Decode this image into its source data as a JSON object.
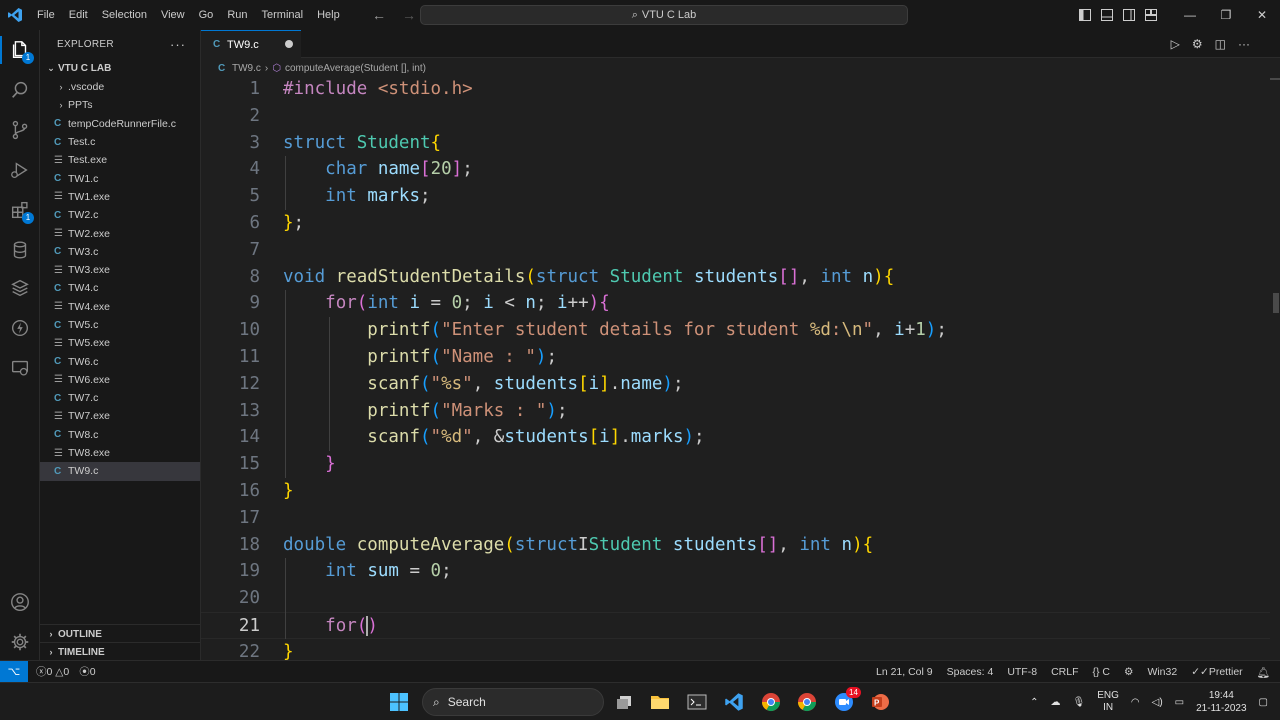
{
  "titlebar": {
    "menu": [
      "File",
      "Edit",
      "Selection",
      "View",
      "Go",
      "Run",
      "Terminal",
      "Help"
    ],
    "search_text": "VTU C Lab"
  },
  "sidebar": {
    "header": "EXPLORER",
    "root_folder": "VTU C LAB",
    "items": [
      {
        "name": ".vscode",
        "kind": "folder"
      },
      {
        "name": "PPTs",
        "kind": "folder"
      },
      {
        "name": "tempCodeRunnerFile.c",
        "kind": "c"
      },
      {
        "name": "Test.c",
        "kind": "c"
      },
      {
        "name": "Test.exe",
        "kind": "exe"
      },
      {
        "name": "TW1.c",
        "kind": "c"
      },
      {
        "name": "TW1.exe",
        "kind": "exe"
      },
      {
        "name": "TW2.c",
        "kind": "c"
      },
      {
        "name": "TW2.exe",
        "kind": "exe"
      },
      {
        "name": "TW3.c",
        "kind": "c"
      },
      {
        "name": "TW3.exe",
        "kind": "exe"
      },
      {
        "name": "TW4.c",
        "kind": "c"
      },
      {
        "name": "TW4.exe",
        "kind": "exe"
      },
      {
        "name": "TW5.c",
        "kind": "c"
      },
      {
        "name": "TW5.exe",
        "kind": "exe"
      },
      {
        "name": "TW6.c",
        "kind": "c"
      },
      {
        "name": "TW6.exe",
        "kind": "exe"
      },
      {
        "name": "TW7.c",
        "kind": "c"
      },
      {
        "name": "TW7.exe",
        "kind": "exe"
      },
      {
        "name": "TW8.c",
        "kind": "c"
      },
      {
        "name": "TW8.exe",
        "kind": "exe"
      },
      {
        "name": "TW9.c",
        "kind": "c",
        "selected": true
      }
    ],
    "outline_label": "OUTLINE",
    "timeline_label": "TIMELINE",
    "file_icon_c": "C",
    "file_icon_exe": "☰"
  },
  "activity": {
    "extensions_badge": "1",
    "explorer_badge": "1"
  },
  "editor": {
    "tab_label": "TW9.c",
    "tab_icon": "C",
    "breadcrumb_file": "TW9.c",
    "breadcrumb_symbol": "computeAverage(Student [], int)",
    "lines": [
      [
        [
          "kw-pre",
          "#include"
        ],
        [
          "punc",
          " "
        ],
        [
          "inc",
          "<stdio.h>"
        ]
      ],
      [],
      [
        [
          "kw",
          "struct"
        ],
        [
          "punc",
          " "
        ],
        [
          "type",
          "Student"
        ],
        [
          "br1",
          "{"
        ]
      ],
      [
        [
          "punc",
          "    "
        ],
        [
          "kw",
          "char"
        ],
        [
          "punc",
          " "
        ],
        [
          "var",
          "name"
        ],
        [
          "br2",
          "["
        ],
        [
          "num",
          "20"
        ],
        [
          "br2",
          "]"
        ],
        [
          "punc",
          ";"
        ]
      ],
      [
        [
          "punc",
          "    "
        ],
        [
          "kw",
          "int"
        ],
        [
          "punc",
          " "
        ],
        [
          "var",
          "marks"
        ],
        [
          "punc",
          ";"
        ]
      ],
      [
        [
          "br1",
          "}"
        ],
        [
          "punc",
          ";"
        ]
      ],
      [],
      [
        [
          "kw",
          "void"
        ],
        [
          "punc",
          " "
        ],
        [
          "fn",
          "readStudentDetails"
        ],
        [
          "br1",
          "("
        ],
        [
          "kw",
          "struct"
        ],
        [
          "punc",
          " "
        ],
        [
          "type",
          "Student"
        ],
        [
          "punc",
          " "
        ],
        [
          "var",
          "students"
        ],
        [
          "br2",
          "[]"
        ],
        [
          "punc",
          ", "
        ],
        [
          "kw",
          "int"
        ],
        [
          "punc",
          " "
        ],
        [
          "var",
          "n"
        ],
        [
          "br1",
          ")"
        ],
        [
          "br1",
          "{"
        ]
      ],
      [
        [
          "punc",
          "    "
        ],
        [
          "ctrl",
          "for"
        ],
        [
          "br2",
          "("
        ],
        [
          "kw",
          "int"
        ],
        [
          "punc",
          " "
        ],
        [
          "var",
          "i"
        ],
        [
          "punc",
          " = "
        ],
        [
          "num",
          "0"
        ],
        [
          "punc",
          "; "
        ],
        [
          "var",
          "i"
        ],
        [
          "punc",
          " < "
        ],
        [
          "var",
          "n"
        ],
        [
          "punc",
          "; "
        ],
        [
          "var",
          "i"
        ],
        [
          "punc",
          "++"
        ],
        [
          "br2",
          ")"
        ],
        [
          "br2",
          "{"
        ]
      ],
      [
        [
          "punc",
          "        "
        ],
        [
          "fn",
          "printf"
        ],
        [
          "br3",
          "("
        ],
        [
          "str",
          "\"Enter student details for student "
        ],
        [
          "esc",
          "%d"
        ],
        [
          "str",
          ":"
        ],
        [
          "esc",
          "\\n"
        ],
        [
          "str",
          "\""
        ],
        [
          "punc",
          ", "
        ],
        [
          "var",
          "i"
        ],
        [
          "punc",
          "+"
        ],
        [
          "num",
          "1"
        ],
        [
          "br3",
          ")"
        ],
        [
          "punc",
          ";"
        ]
      ],
      [
        [
          "punc",
          "        "
        ],
        [
          "fn",
          "printf"
        ],
        [
          "br3",
          "("
        ],
        [
          "str",
          "\"Name : \""
        ],
        [
          "br3",
          ")"
        ],
        [
          "punc",
          ";"
        ]
      ],
      [
        [
          "punc",
          "        "
        ],
        [
          "fn",
          "scanf"
        ],
        [
          "br3",
          "("
        ],
        [
          "str",
          "\""
        ],
        [
          "esc",
          "%s"
        ],
        [
          "str",
          "\""
        ],
        [
          "punc",
          ", "
        ],
        [
          "var",
          "students"
        ],
        [
          "br1",
          "["
        ],
        [
          "var",
          "i"
        ],
        [
          "br1",
          "]"
        ],
        [
          "punc",
          "."
        ],
        [
          "var",
          "name"
        ],
        [
          "br3",
          ")"
        ],
        [
          "punc",
          ";"
        ]
      ],
      [
        [
          "punc",
          "        "
        ],
        [
          "fn",
          "printf"
        ],
        [
          "br3",
          "("
        ],
        [
          "str",
          "\"Marks : \""
        ],
        [
          "br3",
          ")"
        ],
        [
          "punc",
          ";"
        ]
      ],
      [
        [
          "punc",
          "        "
        ],
        [
          "fn",
          "scanf"
        ],
        [
          "br3",
          "("
        ],
        [
          "str",
          "\""
        ],
        [
          "esc",
          "%d"
        ],
        [
          "str",
          "\""
        ],
        [
          "punc",
          ", &"
        ],
        [
          "var",
          "students"
        ],
        [
          "br1",
          "["
        ],
        [
          "var",
          "i"
        ],
        [
          "br1",
          "]"
        ],
        [
          "punc",
          "."
        ],
        [
          "var",
          "marks"
        ],
        [
          "br3",
          ")"
        ],
        [
          "punc",
          ";"
        ]
      ],
      [
        [
          "punc",
          "    "
        ],
        [
          "br2",
          "}"
        ]
      ],
      [
        [
          "br1",
          "}"
        ]
      ],
      [],
      [
        [
          "kw",
          "double"
        ],
        [
          "punc",
          " "
        ],
        [
          "fn",
          "computeAverage"
        ],
        [
          "br1",
          "("
        ],
        [
          "kw",
          "struct"
        ],
        [
          "cursor-i",
          "I"
        ],
        [
          "type",
          "Student"
        ],
        [
          "punc",
          " "
        ],
        [
          "var",
          "students"
        ],
        [
          "br2",
          "[]"
        ],
        [
          "punc",
          ", "
        ],
        [
          "kw",
          "int"
        ],
        [
          "punc",
          " "
        ],
        [
          "var",
          "n"
        ],
        [
          "br1",
          ")"
        ],
        [
          "br1",
          "{"
        ]
      ],
      [
        [
          "punc",
          "    "
        ],
        [
          "kw",
          "int"
        ],
        [
          "punc",
          " "
        ],
        [
          "var",
          "sum"
        ],
        [
          "punc",
          " = "
        ],
        [
          "num",
          "0"
        ],
        [
          "punc",
          ";"
        ]
      ],
      [],
      [
        [
          "punc",
          "    "
        ],
        [
          "ctrl",
          "for"
        ],
        [
          "br2",
          "("
        ],
        [
          "caret",
          ""
        ],
        [
          "br2",
          ")"
        ]
      ],
      [
        [
          "br1",
          "}"
        ]
      ]
    ],
    "current_line": 21
  },
  "statusbar": {
    "errors": "0",
    "warnings": "0",
    "ports": "0",
    "position": "Ln 21, Col 9",
    "spaces": "Spaces: 4",
    "encoding": "UTF-8",
    "eol": "CRLF",
    "language": "C",
    "platform": "Win32",
    "formatter": "Prettier"
  },
  "taskbar": {
    "search_label": "Search",
    "notif_badge": "14",
    "lang_top": "ENG",
    "lang_bottom": "IN",
    "time": "19:44",
    "date": "21-11-2023"
  },
  "colors": {
    "accent": "#0078d4",
    "background": "#1f1f1f",
    "sidebar": "#181818"
  }
}
